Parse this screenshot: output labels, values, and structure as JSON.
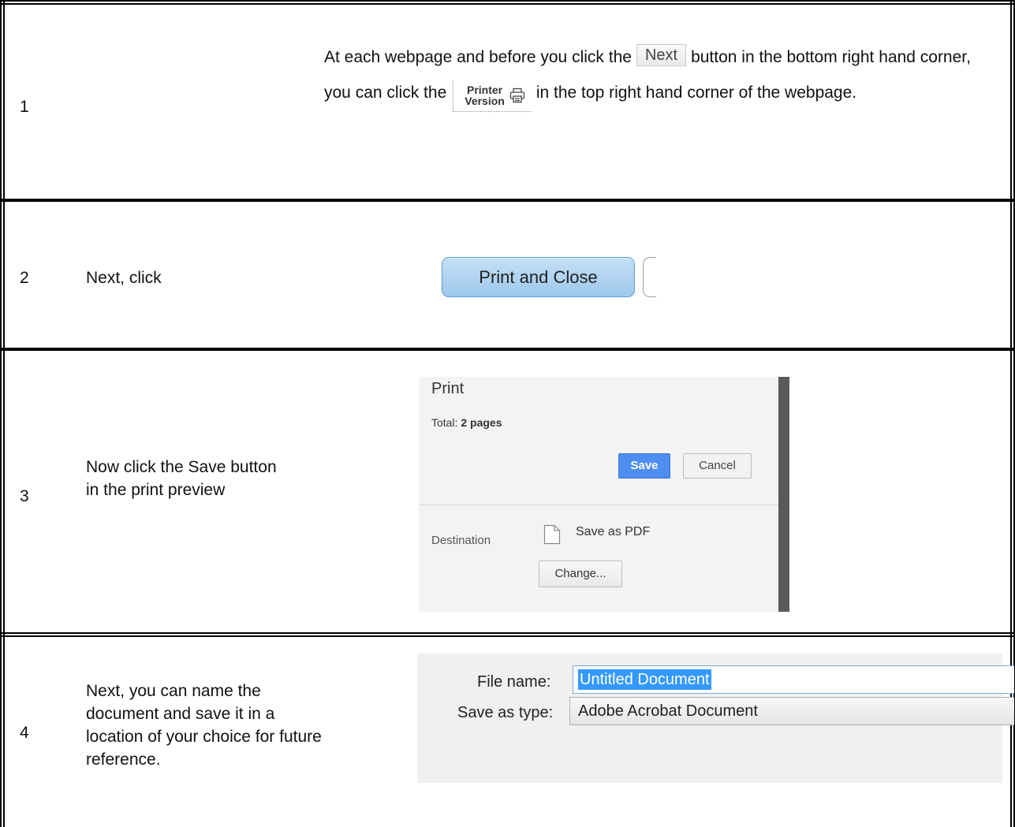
{
  "rows": [
    {
      "number": "1",
      "text_before_next": "At each webpage and before you click the",
      "next_label": "Next",
      "text_after_next": "button in the bottom right hand corner, you can click the",
      "printer_label_line1": "Printer",
      "printer_label_line2": "Version",
      "text_after_printer": "in the top right hand corner of the webpage."
    },
    {
      "number": "2",
      "text": "Next, click",
      "button_label": "Print and Close"
    },
    {
      "number": "3",
      "text": "Now click the Save button in the print preview",
      "preview": {
        "title": "Print",
        "total_prefix": "Total: ",
        "total_value": "2 pages",
        "save_label": "Save",
        "cancel_label": "Cancel",
        "destination_label": "Destination",
        "destination_value": "Save as PDF",
        "change_label": "Change..."
      }
    },
    {
      "number": "4",
      "text": "Next, you can name the document and save it in a location of your choice for future reference.",
      "dialog": {
        "file_name_label": "File name:",
        "file_name_value": "Untitled Document",
        "save_type_label": "Save as type:",
        "save_type_value": "Adobe Acrobat Document"
      }
    }
  ]
}
